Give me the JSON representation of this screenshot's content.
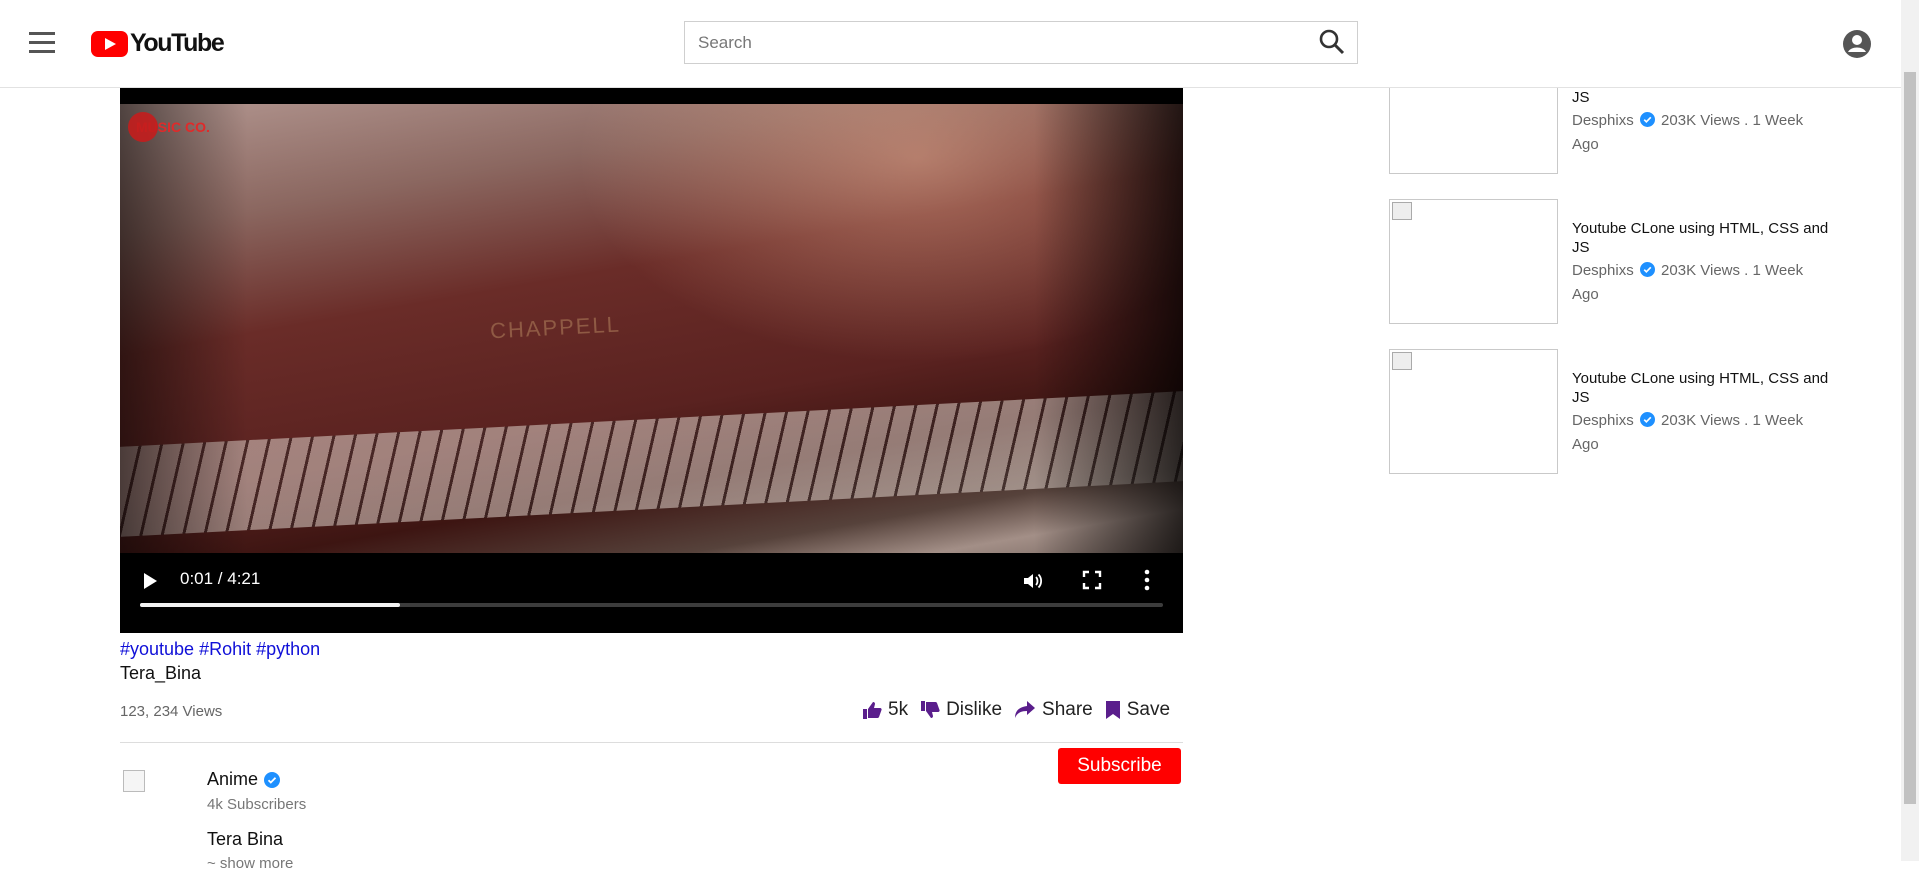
{
  "header": {
    "logo_text": "YouTube",
    "search_placeholder": "Search"
  },
  "video": {
    "overlay_brand": "MUSIC CO.",
    "overlay_text": "CHAPPELL",
    "time_display": "0:01 / 4:21",
    "progress": 0.254
  },
  "details": {
    "tags": [
      "#youtube",
      "#Rohit",
      "#python"
    ],
    "title": "Tera_Bina",
    "views": "123, 234 Views",
    "like_count": "5k",
    "dislike_label": "Dislike",
    "share_label": "Share",
    "save_label": "Save"
  },
  "channel": {
    "name": "Anime",
    "subscribers": "4k Subscribers",
    "description": "Tera Bina",
    "show_more": "~ show more",
    "subscribe_label": "Subscribe"
  },
  "recommendations": [
    {
      "title": "Youtube CLone using HTML, CSS and JS",
      "channel": "Desphixs",
      "stats": "203K Views . 1 Week Ago"
    },
    {
      "title": "Youtube CLone using HTML, CSS and JS",
      "channel": "Desphixs",
      "stats": "203K Views . 1 Week Ago"
    },
    {
      "title": "Youtube CLone using HTML, CSS and JS",
      "channel": "Desphixs",
      "stats": "203K Views . 1 Week Ago"
    }
  ],
  "colors": {
    "brand_red": "#ff0000",
    "tag_blue": "#1010d8",
    "action_purple": "#5a1e8c",
    "verified_blue": "#1e90ff"
  }
}
